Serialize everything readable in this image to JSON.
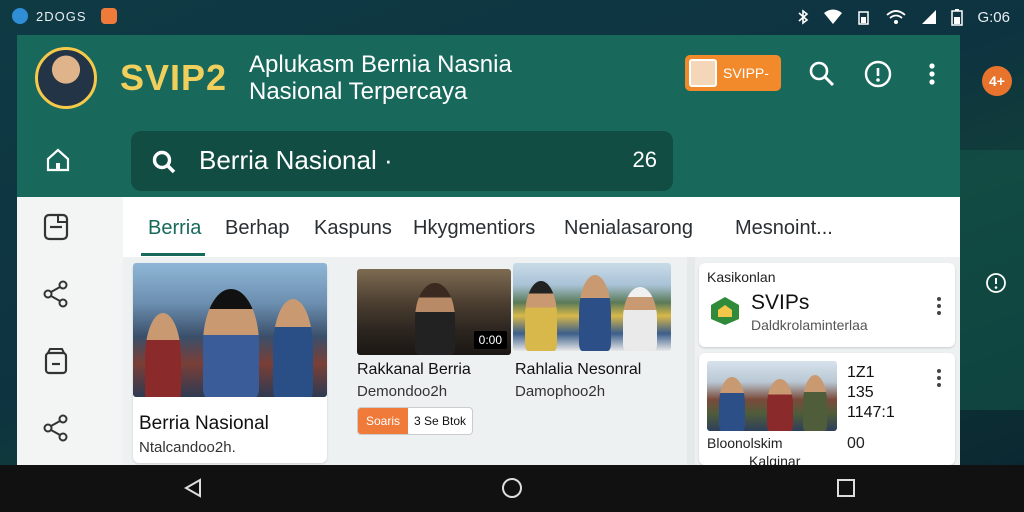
{
  "status_bar": {
    "left_text": "2DOGS",
    "time": "G:06",
    "icons": [
      "app-icon",
      "notification-icon",
      "bluetooth-icon",
      "wifi-icon",
      "signal-icon",
      "battery-icon"
    ]
  },
  "header": {
    "brand": "SVIP2",
    "tagline_line1": "Aplukasm Bernia Nasnia",
    "tagline_line2": "Nasional Terpercaya",
    "promo_label": "SVIPP-",
    "search_icon": "search-icon",
    "info_icon": "info-icon",
    "menu_icon": "more-vert-icon",
    "brand_color": "#f1cf5c",
    "header_color": "#18695c"
  },
  "search": {
    "value": "Berria Nasional ·",
    "count": "26"
  },
  "tabs": [
    {
      "label": "Berria",
      "active": true
    },
    {
      "label": "Berhap",
      "active": false
    },
    {
      "label": "Kaspuns",
      "active": false
    },
    {
      "label": "Hkygmentiors",
      "active": false
    },
    {
      "label": "Nenialasarong",
      "active": false
    },
    {
      "label": "Mesnoint...",
      "active": false
    }
  ],
  "rail": [
    "home-icon",
    "news-icon",
    "share-icon",
    "archive-icon",
    "share-icon"
  ],
  "cards": {
    "main": {
      "title": "Berria Nasional",
      "subtitle": "Ntalcandoo2h."
    },
    "card2": {
      "title": "Rakkanal Berria",
      "subtitle": "Demondoo2h",
      "video_label": "0:00",
      "badge_left": "Soaris",
      "badge_right": "3 Se Btok"
    },
    "card3": {
      "title": "Rahlalia Nesonral",
      "subtitle": "Damophoo2h"
    }
  },
  "side_panel": {
    "header": "Kasikonlan",
    "brand": "SVIPs",
    "brand_sub": "Daldkrolaminterlaa",
    "item": {
      "line1": "1Z1",
      "line2": "135",
      "line3": "1147:1",
      "caption": "Bloonolskim",
      "count": "00",
      "footer": "Kalginar"
    }
  },
  "accent_color": "#f28a2c",
  "fab_label": "4+"
}
